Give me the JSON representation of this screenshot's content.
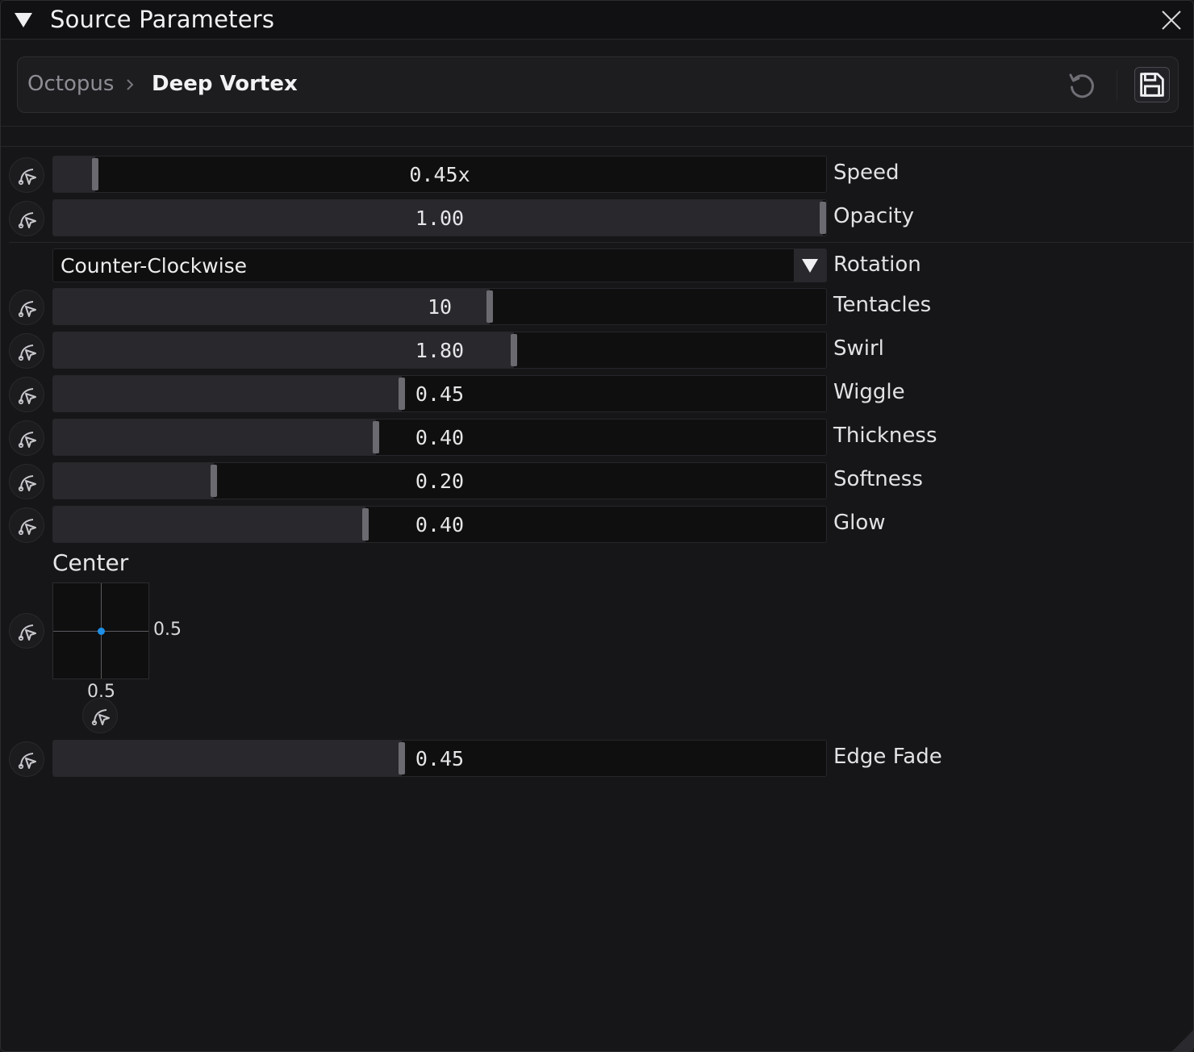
{
  "panel": {
    "title": "Source Parameters",
    "collapse_icon": "caret-down-icon",
    "close_icon": "close-icon"
  },
  "breadcrumb": {
    "root": "Octopus",
    "current": "Deep Vortex",
    "reset_icon": "reset-icon",
    "save_icon": "save-icon"
  },
  "params": {
    "speed": {
      "label": "Speed",
      "value": "0.45x",
      "level": 0.05
    },
    "opacity": {
      "label": "Opacity",
      "value": "1.00",
      "level": 1.0
    },
    "rotation": {
      "label": "Rotation",
      "value": "Counter-Clockwise"
    },
    "tentacles": {
      "label": "Tentacles",
      "value": "10",
      "level": 0.565
    },
    "swirl": {
      "label": "Swirl",
      "value": "1.80",
      "level": 0.597
    },
    "wiggle": {
      "label": "Wiggle",
      "value": "0.45",
      "level": 0.451
    },
    "thickness": {
      "label": "Thickness",
      "value": "0.40",
      "level": 0.417
    },
    "softness": {
      "label": "Softness",
      "value": "0.20",
      "level": 0.205
    },
    "glow": {
      "label": "Glow",
      "value": "0.40",
      "level": 0.403
    },
    "edge_fade": {
      "label": "Edge Fade",
      "value": "0.45",
      "level": 0.451
    }
  },
  "center": {
    "label": "Center",
    "x": "0.5",
    "y": "0.5",
    "x_level": 0.5,
    "y_level": 0.5,
    "dot_color": "#1e90e6"
  },
  "colors": {
    "background": "#161618",
    "slider_fill": "#29292d",
    "handle": "#6a6a70",
    "accent": "#1e90e6"
  },
  "modulation_icon": "modulate-icon"
}
